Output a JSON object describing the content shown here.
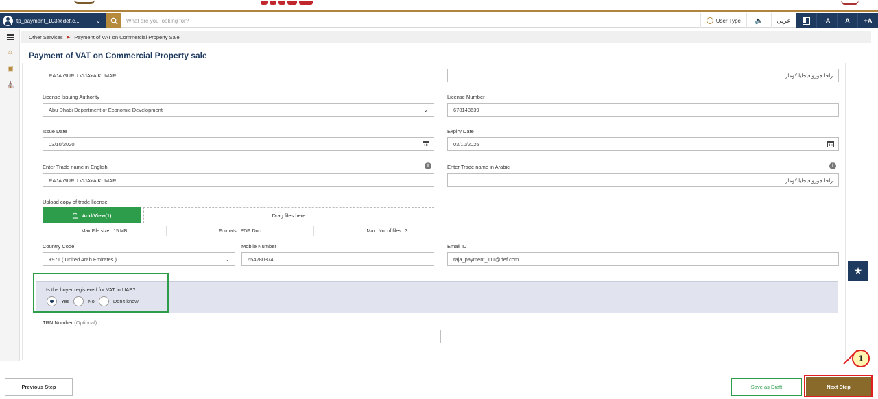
{
  "header": {
    "username": "tp_payment_103@def.c...",
    "search_placeholder": "What are you looking for?",
    "user_type_label": "User Type",
    "language_label": "عربي",
    "font_decrease": "-A",
    "font_default": "A",
    "font_increase": "+A"
  },
  "breadcrumb": {
    "parent": "Other Services",
    "current": "Payment of VAT on Commercial Property Sale"
  },
  "page": {
    "title": "Payment of VAT on Commercial Property sale"
  },
  "form": {
    "name_en": "RAJA GURU VIJAYA KUMAR",
    "name_ar": "راجا جورو فيجايا كومار",
    "license_authority": {
      "label": "License Issuing Authority",
      "value": "Abu Dhabi Department of Economic Development"
    },
    "license_number": {
      "label": "License Number",
      "value": "678143639"
    },
    "issue_date": {
      "label": "Issue Date",
      "value": "03/10/2020"
    },
    "expiry_date": {
      "label": "Expiry Date",
      "value": "03/10/2025"
    },
    "trade_name_en": {
      "label": "Enter Trade name in English",
      "value": "RAJA GURU VIJAYA KUMAR"
    },
    "trade_name_ar": {
      "label": "Enter Trade name in Arabic",
      "value": "راجا جورو فيجايا كومار"
    },
    "upload": {
      "label": "Upload copy of trade license",
      "add_button": "Add/View(1)",
      "drop_text": "Drag files here",
      "max_size": "Max File size : 15 MB",
      "formats": "Formats : PDF, Doc",
      "max_files": "Max. No. of files : 3"
    },
    "country_code": {
      "label": "Country Code",
      "value": "+971 ( United Arab Emirates )"
    },
    "mobile": {
      "label": "Mobile Number",
      "value": "654280374"
    },
    "email": {
      "label": "Email ID",
      "value": "raja_payment_111@def.com"
    },
    "vat_registered": {
      "question": "Is the buyer registered for VAT in UAE?",
      "options": [
        "Yes",
        "No",
        "Don't know"
      ],
      "selected": "Yes"
    },
    "trn": {
      "label": "TRN Number",
      "optional": "(Optional)",
      "value": ""
    }
  },
  "footer": {
    "previous": "Previous Step",
    "save_draft": "Save as Draft",
    "next": "Next Step"
  },
  "annotation": {
    "callout_number": "1"
  },
  "colors": {
    "navy": "#1e3a5f",
    "gold": "#b68a3d",
    "green": "#2e9d4b",
    "next_brown": "#8a6a2a",
    "highlight_red": "#e02020"
  },
  "icons": {
    "user": "user-avatar-icon",
    "search": "search-icon",
    "speaker": "speaker-icon",
    "contrast": "contrast-icon",
    "star": "star-icon",
    "calendar": "calendar-icon",
    "info": "info-icon",
    "upload": "upload-icon"
  }
}
